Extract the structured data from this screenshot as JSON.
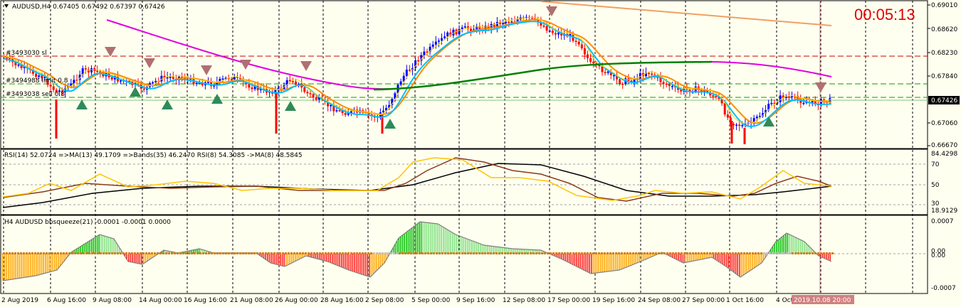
{
  "main": {
    "header": "AUDUSD,H4  0.67405 0.67492 0.67397 0.67426",
    "timer": "00:05:13",
    "price_labels": [
      "0.69010",
      "0.68620",
      "0.68230",
      "0.67840",
      "0.67426",
      "0.67060",
      "0.66670"
    ],
    "current_price": "0.67426",
    "order_tags": [
      "#3493030 sl",
      "#3494988 limit 0.8",
      "#3493038 sell 0.8"
    ]
  },
  "rsi": {
    "header": "RSI(14) 52.0724  =>MA(13) 49.1709  =>Bands(35) 46.2470  RSI(8) 54.3085  ->MA(8) 48.5845",
    "labels": [
      "84.4298",
      "70",
      "50",
      "30",
      "18.9129"
    ]
  },
  "squeeze": {
    "header": "H4 AUDUSD bbsqueeze(21) -0.0001 -0.0001 0.0000",
    "labels": [
      "0.0007",
      "0.00",
      "0.00",
      "-0.0007"
    ]
  },
  "time_axis": {
    "labels": [
      "2 Aug 2019",
      "6 Aug 16:00",
      "9 Aug 08:00",
      "14 Aug 00:00",
      "16 Aug 16:00",
      "21 Aug 08:00",
      "26 Aug 00:00",
      "28 Aug 16:00",
      "2 Sep 08:00",
      "5 Sep 00:00",
      "9 Sep 16:00",
      "12 Sep 08:00",
      "17 Sep 00:00",
      "19 Sep 16:00",
      "24 Sep 08:00",
      "27 Sep 00:00",
      "1 Oct 16:00",
      "4 Oct"
    ],
    "cursor_time": "2019.10.08 20:00"
  },
  "colors": {
    "background": "#fffff0",
    "bull_candle": "#0000ff",
    "bear_candle": "#ff0000",
    "ma_slow": "#e000e0",
    "ma_long": "#008000",
    "trend_line": "#f0a060",
    "ema_fast": "#00bfff",
    "ema_mid": "#ff8c00",
    "timer": "#e00000"
  }
}
